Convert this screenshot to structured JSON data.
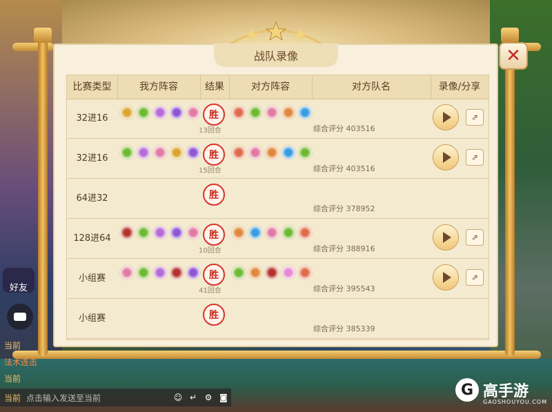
{
  "dialog": {
    "title": "战队录像"
  },
  "headers": {
    "type": "比赛类型",
    "mine": "我方阵容",
    "result": "结果",
    "theirs": "对方阵容",
    "team": "对方队名",
    "replay": "录像/分享"
  },
  "rows": [
    {
      "type": "32进16",
      "result": "胜",
      "rounds": "13回合",
      "score": "综合评分 403516",
      "mine": [
        "#d9a52e",
        "#6fb82f",
        "#b56ad6",
        "#8f55d3",
        "#e07aa0"
      ],
      "theirs": [
        "#e06a4a",
        "#6fb82f",
        "#e07aa0",
        "#e0873a",
        "#3a9be0"
      ],
      "has_replay": true
    },
    {
      "type": "32进16",
      "result": "胜",
      "rounds": "15回合",
      "score": "综合评分 403516",
      "mine": [
        "#6fb82f",
        "#b56ad6",
        "#e07aa0",
        "#d9a52e",
        "#8f55d3"
      ],
      "theirs": [
        "#e06a4a",
        "#e07aa0",
        "#e0873a",
        "#3a9be0",
        "#6fb82f"
      ],
      "has_replay": true
    },
    {
      "type": "64进32",
      "result": "胜",
      "rounds": "",
      "score": "综合评分 378952",
      "mine": [],
      "theirs": [],
      "has_replay": false
    },
    {
      "type": "128进64",
      "result": "胜",
      "rounds": "10回合",
      "score": "综合评分 388916",
      "mine": [
        "#b5302a",
        "#6fb82f",
        "#b56ad6",
        "#8f55d3",
        "#e07aa0"
      ],
      "theirs": [
        "#e0873a",
        "#3a9be0",
        "#e07aa0",
        "#6fb82f",
        "#e06a4a"
      ],
      "has_replay": true
    },
    {
      "type": "小组赛",
      "result": "胜",
      "rounds": "41回合",
      "score": "综合评分 395543",
      "mine": [
        "#e07aa0",
        "#6fb82f",
        "#b56ad6",
        "#b5302a",
        "#8f55d3"
      ],
      "theirs": [
        "#6fb82f",
        "#e0873a",
        "#b5302a",
        "#e58ad0",
        "#e06a4a"
      ],
      "has_replay": true
    },
    {
      "type": "小组赛",
      "result": "胜",
      "rounds": "",
      "score": "综合评分 385339",
      "mine": [],
      "theirs": [],
      "has_replay": false
    }
  ],
  "hud": {
    "friend_label": "好友",
    "chat_lines": [
      {
        "text": "当前",
        "color": "#f0c070"
      },
      {
        "text": "法术连击",
        "color": "#ff8844"
      },
      {
        "text": "当前",
        "color": "#f0c070"
      }
    ],
    "input_channel": "当前",
    "input_placeholder": "点击输入发送至当前"
  },
  "watermark": {
    "text": "高手游",
    "url": "GAOSHOUYOU.COM",
    "glyph": "G"
  }
}
